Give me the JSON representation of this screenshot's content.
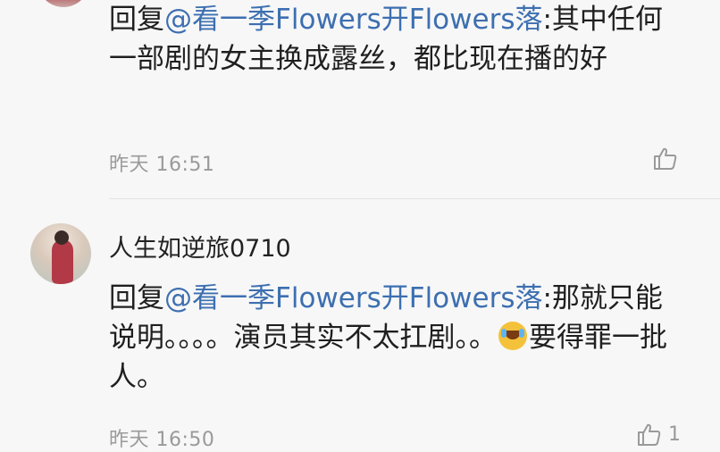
{
  "comments": [
    {
      "reply_prefix": "回复",
      "mention": "@看一季Flowers开Flowers落",
      "text": ":其中任何一部剧的女主换成露丝，都比现在播的好",
      "time": "昨天 16:51",
      "like_count": ""
    },
    {
      "username": "人生如逆旅0710",
      "reply_prefix": "回复",
      "mention": "@看一季Flowers开Flowers落",
      "text_before_emoji": ":那就只能说明。。。。演员其实不太扛剧。。",
      "emoji_name": "laughing-crying-emoji",
      "text_after_emoji": "要得罪一批人。",
      "time": "昨天 16:50",
      "like_count": "1"
    }
  ],
  "icons": {
    "like": "thumbs-up-icon"
  },
  "colors": {
    "background": "#f7f7f7",
    "mention": "#3d6fb0",
    "meta": "#9a9a9a"
  }
}
